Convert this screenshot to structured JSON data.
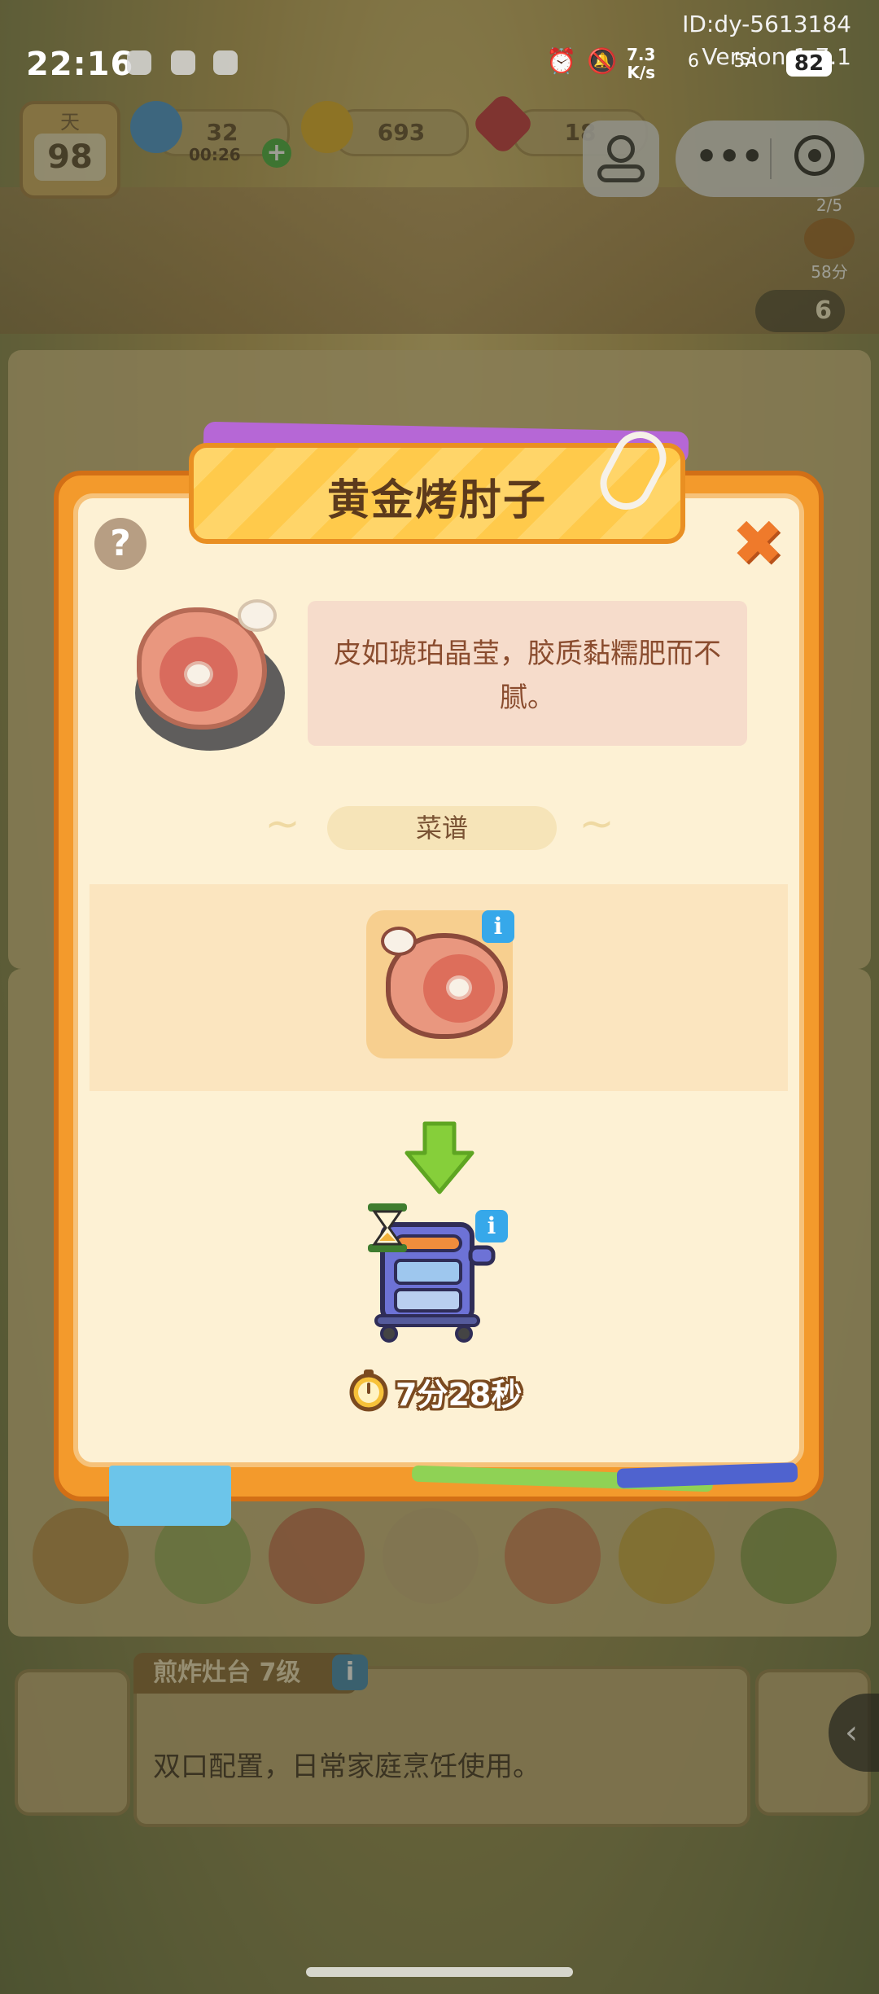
{
  "status_bar": {
    "time": "22:16",
    "account_id": "ID:dy-5613184",
    "version": "Version:1.7.1",
    "net_speed_value": "7.3",
    "net_speed_unit": "K/s",
    "network_label": "6",
    "signal_label": "5A",
    "battery": "82"
  },
  "hud": {
    "day_label": "天",
    "day_value": "98",
    "energy_value": "32",
    "energy_timer": "00:26",
    "coins_value": "693",
    "gems_value": "18",
    "order_progress": "2/5",
    "order_time": "58分",
    "tip_count": "6"
  },
  "modal": {
    "title": "黄金烤肘子",
    "help_label": "?",
    "close_label": "✖",
    "description": "皮如琥珀晶莹，胶质黏糯肥而不腻。",
    "recipe_label": "菜谱",
    "info_label": "i",
    "cook_time": "7分28秒"
  },
  "station": {
    "title": "煎炸灶台 7级",
    "description": "双口配置，日常家庭烹饪使用。"
  },
  "icons": {
    "side_arrow": "‹"
  },
  "colors": {
    "accent_orange": "#f39a2c",
    "panel_cream": "#fdf1d4",
    "info_blue": "#36a8ea"
  }
}
